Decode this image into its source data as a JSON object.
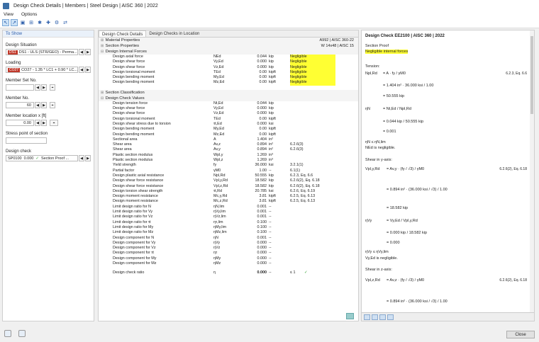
{
  "window": {
    "title": "Design Check Details | Members | Steel Design | AISC 360 | 2022"
  },
  "menu": [
    "View",
    "Options"
  ],
  "left": {
    "header": "To Show",
    "design_situation_label": "Design Situation",
    "design_situation_badge": "DS1",
    "design_situation_value": "DS1 - ULS (STR/GEO) - Perma...",
    "loading_label": "Loading",
    "loading_badge": "CO27",
    "loading_value": "CO27 - 1.35 * LC1 + 0.90 * LC...",
    "member_set_label": "Member Set No.",
    "member_label": "Member No.",
    "member_value": "60",
    "member_location_label": "Member location x [ft]",
    "member_location_value": "0.00",
    "stress_point_label": "Stress point of section",
    "design_check_label": "Design check",
    "design_check_id": "SP0100",
    "design_check_value": "0.000",
    "design_check_type": "Section Proof ..."
  },
  "center": {
    "tabs": [
      "Design Check Details",
      "Design Checks in Location"
    ],
    "material_label": "Material Properties",
    "material_value": "A992 | AISC 360-22",
    "section_label": "Section Properties",
    "section_value": "W 14x48 | AISC 15",
    "forces_label": "Design Internal Forces",
    "forces": [
      {
        "n": "Design axial force",
        "s": "NEd",
        "v": "0.044",
        "u": "kip",
        "r": "Negligible"
      },
      {
        "n": "Design shear force",
        "s": "Vy,Ed",
        "v": "0.000",
        "u": "kip",
        "r": "Negligible"
      },
      {
        "n": "Design shear force",
        "s": "Vz,Ed",
        "v": "0.000",
        "u": "kip",
        "r": "Negligible"
      },
      {
        "n": "Design torsional moment",
        "s": "TEd",
        "v": "0.00",
        "u": "kipft",
        "r": "Negligible"
      },
      {
        "n": "Design bending moment",
        "s": "My,Ed",
        "v": "0.00",
        "u": "kipft",
        "r": "Negligible"
      },
      {
        "n": "Design bending moment",
        "s": "Mz,Ed",
        "v": "0.00",
        "u": "kipft",
        "r": "Negligible"
      }
    ],
    "classification_label": "Section Classification",
    "values_label": "Design Check Values",
    "values": [
      {
        "n": "Design tension force",
        "s": "Nt,Ed",
        "v": "0.044",
        "u": "kip",
        "r": ""
      },
      {
        "n": "Design shear force",
        "s": "Vy,Ed",
        "v": "0.000",
        "u": "kip",
        "r": ""
      },
      {
        "n": "Design shear force",
        "s": "Vz,Ed",
        "v": "0.000",
        "u": "kip",
        "r": ""
      },
      {
        "n": "Design torsional moment",
        "s": "TEd",
        "v": "0.00",
        "u": "kipft",
        "r": ""
      },
      {
        "n": "Design shear stress due to torsion",
        "s": "τt,Ed",
        "v": "0.000",
        "u": "ksi",
        "r": ""
      },
      {
        "n": "Design bending moment",
        "s": "My,Ed",
        "v": "0.00",
        "u": "kipft",
        "r": ""
      },
      {
        "n": "Design bending moment",
        "s": "Mz,Ed",
        "v": "0.00",
        "u": "kipft",
        "r": ""
      },
      {
        "n": "Sectional area",
        "s": "A",
        "v": "1.404",
        "u": "in²",
        "r": ""
      },
      {
        "n": "Shear area",
        "s": "Av,z",
        "v": "0.894",
        "u": "in²",
        "r": "6.2.6(3)"
      },
      {
        "n": "Shear area",
        "s": "Av,y",
        "v": "0.894",
        "u": "in²",
        "r": "6.2.6(3)"
      },
      {
        "n": "Plastic section modulus",
        "s": "Wpl,y",
        "v": "1.269",
        "u": "in³",
        "r": ""
      },
      {
        "n": "Plastic section modulus",
        "s": "Wpl,z",
        "v": "1.269",
        "u": "in³",
        "r": ""
      },
      {
        "n": "Yield strength",
        "s": "fy",
        "v": "36.000",
        "u": "ksi",
        "r": "3.2.1(1)"
      },
      {
        "n": "Partial factor",
        "s": "γM0",
        "v": "1.00",
        "u": "--",
        "r": "6.1(1)"
      },
      {
        "n": "Design plastic axial resistance",
        "s": "Npl,Rd",
        "v": "50.555",
        "u": "kip",
        "r": "6.2.3, Eq. 6.6"
      },
      {
        "n": "Design shear force resistance",
        "s": "Vpl,y,Rd",
        "v": "18.582",
        "u": "kip",
        "r": "6.2.6(2), Eq. 6.18"
      },
      {
        "n": "Design shear force resistance",
        "s": "Vpl,z,Rd",
        "v": "18.582",
        "u": "kip",
        "r": "6.2.6(2), Eq. 6.18"
      },
      {
        "n": "Design torsion shear strength",
        "s": "τt,Rd",
        "v": "20.785",
        "u": "ksi",
        "r": "6.2.6, Eq. 6.19"
      },
      {
        "n": "Design moment resistance",
        "s": "Mc,y,Rd",
        "v": "3.81",
        "u": "kipft",
        "r": "6.2.5, Eq. 6.13"
      },
      {
        "n": "Design moment resistance",
        "s": "Mc,z,Rd",
        "v": "3.81",
        "u": "kipft",
        "r": "6.2.5, Eq. 6.13"
      },
      {
        "n": "Limit design ratio for N",
        "s": "ηN,lim",
        "v": "0.001",
        "u": "--",
        "r": ""
      },
      {
        "n": "Limit design ratio for Vy",
        "s": "ηVy,lim",
        "v": "0.001",
        "u": "--",
        "r": ""
      },
      {
        "n": "Limit design ratio for Vz",
        "s": "ηVz,lim",
        "v": "0.001",
        "u": "--",
        "r": ""
      },
      {
        "n": "Limit design ratio for τt",
        "s": "ητ,lim",
        "v": "0.100",
        "u": "--",
        "r": ""
      },
      {
        "n": "Limit design ratio for My",
        "s": "ηMy,lim",
        "v": "0.100",
        "u": "--",
        "r": ""
      },
      {
        "n": "Limit design ratio for Mz",
        "s": "ηMz,lim",
        "v": "0.100",
        "u": "--",
        "r": ""
      },
      {
        "n": "Design component for N",
        "s": "ηN",
        "v": "0.001",
        "u": "--",
        "r": ""
      },
      {
        "n": "Design component for Vy",
        "s": "ηVy",
        "v": "0.000",
        "u": "--",
        "r": ""
      },
      {
        "n": "Design component for Vz",
        "s": "ηVz",
        "v": "0.000",
        "u": "--",
        "r": ""
      },
      {
        "n": "Design component for τt",
        "s": "ητ",
        "v": "0.000",
        "u": "--",
        "r": ""
      },
      {
        "n": "Design component for My",
        "s": "ηMy",
        "v": "0.000",
        "u": "--",
        "r": ""
      },
      {
        "n": "Design component for Mz",
        "s": "ηMz",
        "v": "0.000",
        "u": "--",
        "r": ""
      }
    ],
    "ratio": {
      "n": "Design check ratio",
      "s": "η",
      "v": "0.000",
      "u": "--",
      "c": "≤ 1",
      "ok": "✓"
    }
  },
  "right": {
    "title": "Design Check EE2100 | AISC 360 | 2022",
    "section_proof": "Section Proof",
    "negligible": "Negligible internal forces",
    "tension": "Tension:",
    "npl": "Npl,Rd",
    "eq1": "=   A  ·  fy / γM0",
    "eq2": "=   1.404 in²  ·  36.000 ksi / 1.00",
    "eq3": "=   50.555 kip",
    "ref1": "6.2.3, Eq. 6.6",
    "etaN": "ηN",
    "eqN1": "=   Nt,Ed / Npl,Rd",
    "eqN2": "=   0.044 kip / 50.555 kip",
    "eqN3": "=   0.001",
    "lim1": "ηN  ≤  ηN,lim",
    "neg1": "NEd is negligible.",
    "shear_y": "Shear in y-axis:",
    "vply": "Vpl,y,Rd",
    "eqV1": "=   Av,y · (fy / √3) / γM0",
    "eqV2": "=   0.894 in² · (36.000 ksi / √3) / 1.00",
    "eqV3": "=   18.582 kip",
    "ref2": "6.2.6(2), Eq. 6.18",
    "etaVy": "ηVy",
    "eqVy1": "=   Vy,Ed / Vpl,y,Rd",
    "eqVy2": "=   0.000 kip / 18.582 kip",
    "eqVy3": "=   0.000",
    "lim2": "ηVy  ≤  ηVy,lim",
    "neg2": "Vy,Ed is negligible.",
    "shear_z": "Shear in z-axis:",
    "vplz": "Vpl,z,Rd",
    "eqZ1": "=   Av,z · (fy / √3) / γM0",
    "eqZ2": "=   0.894 in² · (36.000 ksi / √3) / 1.00",
    "ref3": "6.2.6(2), Eq. 6.18"
  },
  "footer": {
    "close": "Close"
  }
}
